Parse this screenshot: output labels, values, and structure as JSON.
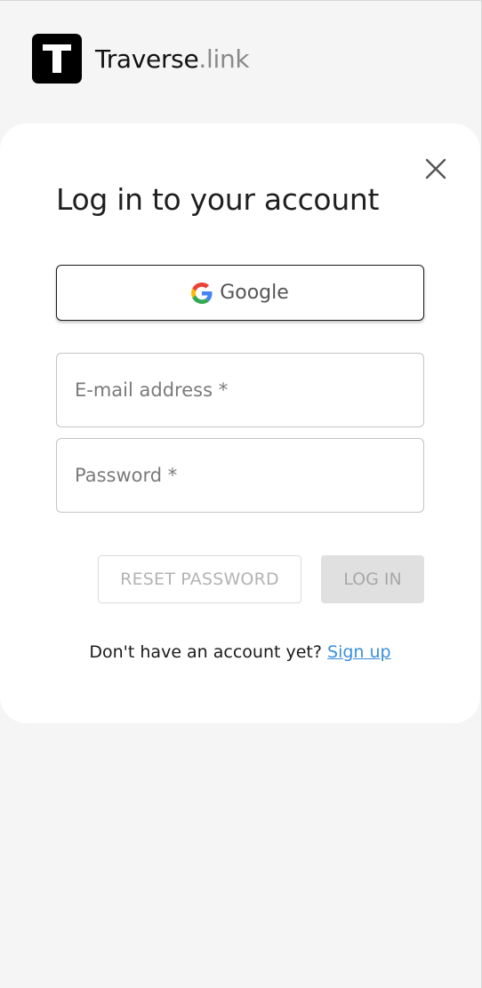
{
  "header": {
    "brand_name": "Traverse",
    "brand_tld": ".link",
    "logo_letter": "T"
  },
  "login_card": {
    "title": "Log in to your account",
    "google_button_label": "Google",
    "email_placeholder": "E-mail address *",
    "email_value": "",
    "password_placeholder": "Password *",
    "password_value": "",
    "reset_password_label": "RESET PASSWORD",
    "login_label": "LOG IN",
    "signup_prompt": "Don't have an account yet?",
    "signup_link": "Sign up"
  },
  "icons": {
    "close": "close-icon",
    "google": "google-icon",
    "logo": "traverse-logo-icon"
  },
  "colors": {
    "background": "#f5f5f5",
    "card": "#ffffff",
    "link": "#3a8fdc",
    "disabled_button": "#e0e0e0",
    "logo_bg": "#000000"
  }
}
